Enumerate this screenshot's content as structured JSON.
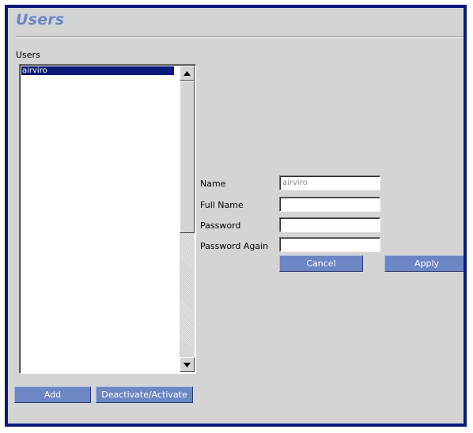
{
  "header": {
    "title": "Users"
  },
  "users_panel": {
    "label": "Users",
    "items": [
      "airviro"
    ],
    "selected_index": 0
  },
  "form": {
    "name_label": "Name",
    "name_value": "airviro",
    "full_name_label": "Full Name",
    "full_name_value": "",
    "password_label": "Password",
    "password_value": "",
    "password_again_label": "Password Again",
    "password_again_value": ""
  },
  "buttons": {
    "add": "Add",
    "deactivate_activate": "Deactivate/Activate",
    "cancel": "Cancel",
    "apply": "Apply"
  },
  "colors": {
    "frame_border": "#0b1a7a",
    "title": "#6b86c2",
    "button": "#6b86c2",
    "selection": "#0b1a7a",
    "background": "#d4d4d4"
  },
  "icons": {
    "scroll_up": "triangle-up-icon",
    "scroll_down": "triangle-down-icon"
  }
}
